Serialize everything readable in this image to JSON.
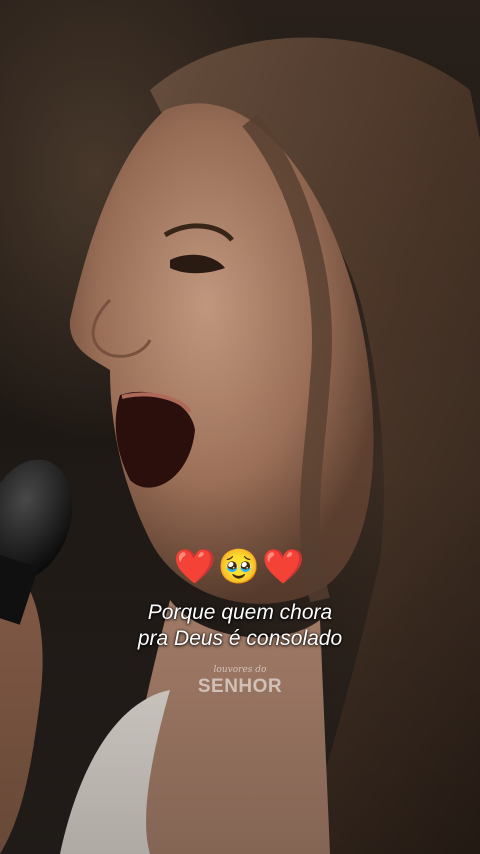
{
  "emojis": "❤️🥹❤️",
  "caption": {
    "line1": "Porque quem chora",
    "line2": "pra Deus é consolado"
  },
  "watermark": {
    "small": "louvores do",
    "big": "SENHOR"
  },
  "colors": {
    "caption_text": "#ffffff",
    "heart": "#e0202a"
  }
}
